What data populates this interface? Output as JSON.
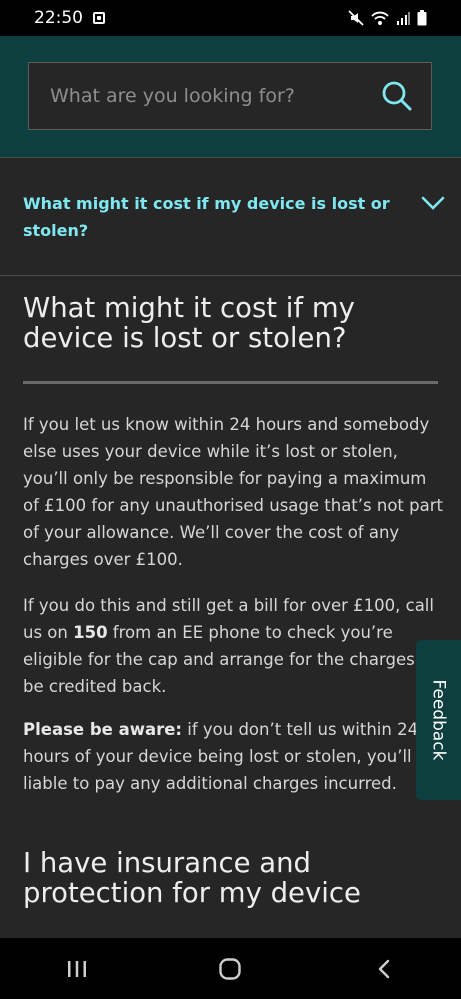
{
  "status_bar": {
    "time": "22:50"
  },
  "search": {
    "placeholder": "What are you looking for?"
  },
  "accordion": {
    "question": "What might it cost if my device is lost or stolen?"
  },
  "article": {
    "title": "What might it cost if my device is lost or stolen?",
    "paragraph1": "If you let us know within 24 hours and somebody else uses your device while it’s lost or stolen, you’ll only be responsible for paying a maximum of £100 for any unauthorised usage that’s not part of your allowance. We’ll cover the cost of any charges over £100.",
    "paragraph2_a": "If you do this and still get a bill for over £100, call us on ",
    "paragraph2_bold": "150",
    "paragraph2_b": " from an EE phone to check you’re eligible for the cap and arrange for the charges to be credited back.",
    "paragraph3_bold": "Please be aware:",
    "paragraph3": " if you don’t tell us within 24 hours of your device being lost or stolen, you’ll be liable to pay any additional charges incurred.",
    "next_heading": "I have insurance and protection for my device"
  },
  "feedback": {
    "label": "Feedback"
  },
  "colors": {
    "header_bg": "#0e3f3f",
    "page_bg": "#262626",
    "accent": "#7fe7f0"
  }
}
